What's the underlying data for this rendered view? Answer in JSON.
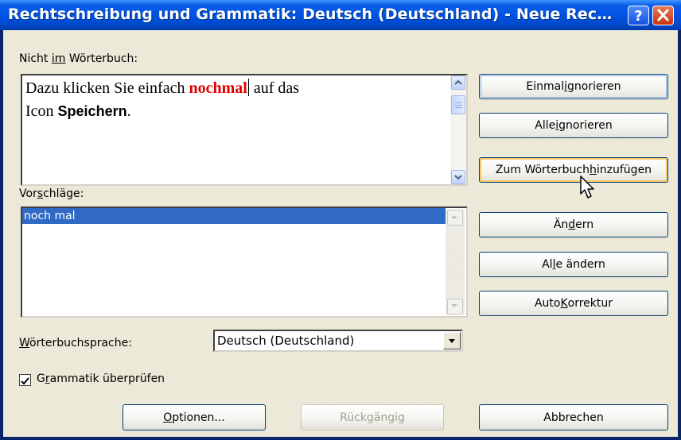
{
  "window": {
    "title": "Rechtschreibung und Grammatik: Deutsch (Deutschland) - Neue Rec…",
    "help_icon": "help-icon",
    "close_icon": "close-icon"
  },
  "not_in_dictionary": {
    "label_pre": "Nicht ",
    "label_u": "im",
    "label_post": " Wörterbuch:",
    "text_before": "Dazu klicken Sie einfach ",
    "error_word": "nochmal",
    "text_after": " auf das",
    "line2_prefix": "Icon ",
    "line2_bold": "Speichern",
    "line2_suffix": "."
  },
  "suggestions": {
    "label_pre": "Vor",
    "label_u": "s",
    "label_post": "chläge:",
    "items": [
      "noch mal"
    ]
  },
  "buttons": {
    "ignore_once": {
      "pre": "Einmal ",
      "u": "i",
      "post": "gnorieren"
    },
    "ignore_all": {
      "pre": "Alle ",
      "u": "i",
      "post": "gnorieren"
    },
    "add_to_dictionary": {
      "pre": "Zum Wörterbuch ",
      "u": "h",
      "post": "inzufügen"
    },
    "change": {
      "pre": "Än",
      "u": "d",
      "post": "ern"
    },
    "change_all": {
      "pre": "Al",
      "u": "l",
      "post": "e ändern"
    },
    "autocorrect": {
      "pre": "Auto",
      "u": "K",
      "post": "orrektur"
    },
    "options": {
      "pre": "",
      "u": "O",
      "post": "ptionen..."
    },
    "undo": {
      "pre": "",
      "u": "",
      "post": "Rückgängig"
    },
    "cancel": {
      "pre": "",
      "u": "",
      "post": "Abbrechen"
    }
  },
  "dictionary_language": {
    "label_pre": "",
    "label_u": "W",
    "label_post": "örterbuchsprache:",
    "selected": "Deutsch (Deutschland)"
  },
  "grammar_check": {
    "label_pre": "G",
    "label_u": "r",
    "label_post": "ammatik überprüfen",
    "checked": true
  }
}
